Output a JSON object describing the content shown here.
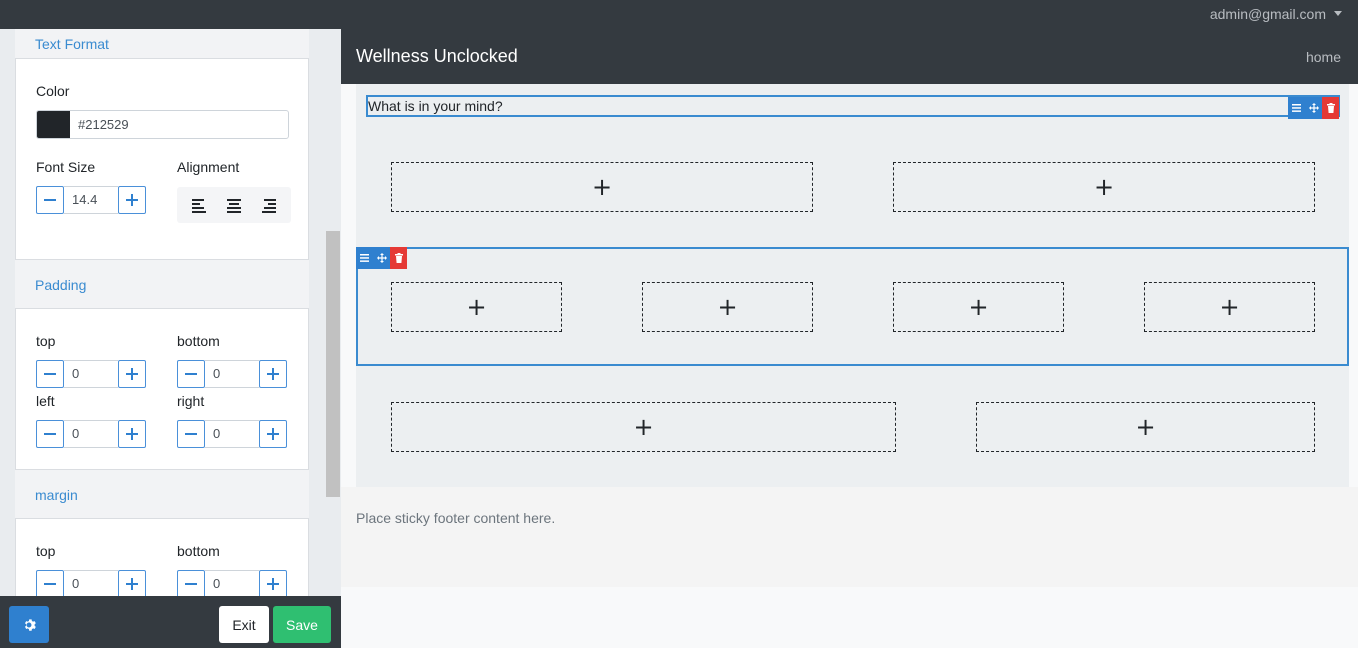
{
  "topbar": {
    "user_email": "admin@gmail.com"
  },
  "panel": {
    "text_format": {
      "title": "Text Format",
      "color_label": "Color",
      "color_value": "#212529",
      "font_size_label": "Font Size",
      "font_size_value": "14.4",
      "alignment_label": "Alignment",
      "alignments": [
        "left",
        "center",
        "right"
      ]
    },
    "padding": {
      "title": "Padding",
      "top_label": "top",
      "top_value": "0",
      "bottom_label": "bottom",
      "bottom_value": "0",
      "left_label": "left",
      "left_value": "0",
      "right_label": "right",
      "right_value": "0"
    },
    "margin": {
      "title": "margin",
      "top_label": "top",
      "top_value": "0",
      "bottom_label": "bottom",
      "bottom_value": "0"
    }
  },
  "bottombar": {
    "exit_label": "Exit",
    "save_label": "Save"
  },
  "canvas": {
    "brand": "Wellness Unclocked",
    "nav_home": "home",
    "text_block": "What is in your mind?",
    "add_symbol": "+",
    "footer_text": "Place sticky footer content here."
  },
  "colors": {
    "accent": "#2f80cf",
    "danger": "#e53935",
    "success": "#2fbf71",
    "dark": "#343a40"
  }
}
